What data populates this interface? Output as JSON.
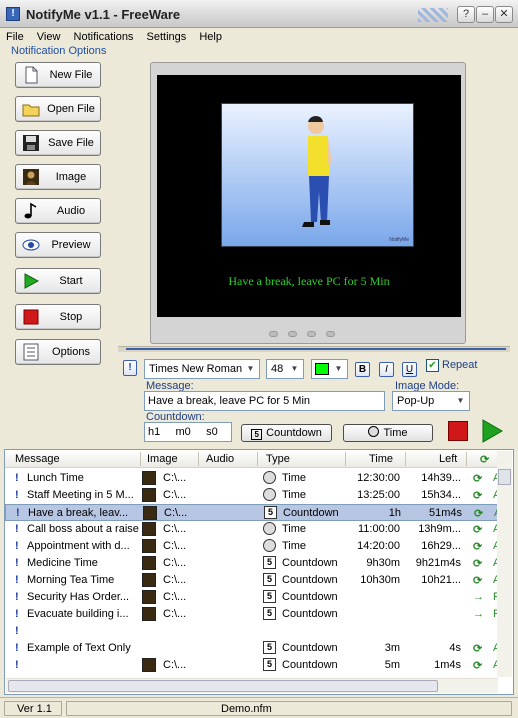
{
  "window": {
    "title": "NotifyMe v1.1 - FreeWare"
  },
  "menu": [
    "File",
    "View",
    "Notifications",
    "Settings",
    "Help"
  ],
  "sidebar": {
    "title": "Notification Options",
    "buttons": [
      "New File",
      "Open File",
      "Save File",
      "Image",
      "Audio",
      "Preview",
      "Start",
      "Stop",
      "Options"
    ]
  },
  "preview": {
    "message": "Have a break, leave PC for 5 Min"
  },
  "editor": {
    "font": "Times New Roman",
    "size": "48",
    "color": "#00ff00",
    "bold_label": "B",
    "italic_label": "I",
    "underline_label": "U",
    "repeat_label": "Repeat",
    "message_label": "Message:",
    "message_value": "Have a break, leave PC for 5 Min",
    "image_mode_label": "Image  Mode:",
    "image_mode_value": "Pop-Up",
    "countdown_label": "Countdown:",
    "countdown_value": "h1     m0     s0",
    "countdown_button": "Countdown",
    "time_button": "Time"
  },
  "table": {
    "headers": [
      "Message",
      "Image",
      "Audio",
      "Type",
      "Time",
      "Left"
    ],
    "rows": [
      {
        "message": "Lunch Time",
        "image": "C:\\...",
        "audio": "",
        "type": "Time",
        "time": "12:30:00",
        "left": "14h39...",
        "flag": "A"
      },
      {
        "message": "Staff Meeting in 5 M...",
        "image": "C:\\...",
        "audio": "",
        "type": "Time",
        "time": "13:25:00",
        "left": "15h34...",
        "flag": "A"
      },
      {
        "message": "Have a break, leav...",
        "image": "C:\\...",
        "audio": "",
        "type": "Countdown",
        "time": "1h",
        "left": "51m4s",
        "flag": "A"
      },
      {
        "message": "Call boss about a raise",
        "image": "C:\\...",
        "audio": "",
        "type": "Time",
        "time": "11:00:00",
        "left": "13h9m...",
        "flag": "A"
      },
      {
        "message": "Appointment with d...",
        "image": "C:\\...",
        "audio": "",
        "type": "Time",
        "time": "14:20:00",
        "left": "16h29...",
        "flag": "A"
      },
      {
        "message": "Medicine Time",
        "image": "C:\\...",
        "audio": "",
        "type": "Countdown",
        "time": "9h30m",
        "left": "9h21m4s",
        "flag": "A"
      },
      {
        "message": "Morning Tea Time",
        "image": "C:\\...",
        "audio": "",
        "type": "Countdown",
        "time": "10h30m",
        "left": "10h21...",
        "flag": "A"
      },
      {
        "message": "Security Has Order...",
        "image": "C:\\...",
        "audio": "",
        "type": "Countdown",
        "time": "",
        "left": "",
        "flag": "F"
      },
      {
        "message": "Evacuate building i...",
        "image": "C:\\...",
        "audio": "",
        "type": "Countdown",
        "time": "",
        "left": "",
        "flag": "F"
      },
      {
        "message": "",
        "image": "",
        "audio": "",
        "type": "",
        "time": "",
        "left": "",
        "flag": ""
      },
      {
        "message": "Example of Text Only",
        "image": "",
        "audio": "",
        "type": "Countdown",
        "time": "3m",
        "left": "4s",
        "flag": "A"
      },
      {
        "message": "",
        "image": "C:\\...",
        "audio": "",
        "type": "Countdown",
        "time": "5m",
        "left": "1m4s",
        "flag": "A"
      }
    ]
  },
  "status": {
    "version": "Ver 1.1",
    "file": "Demo.nfm"
  }
}
